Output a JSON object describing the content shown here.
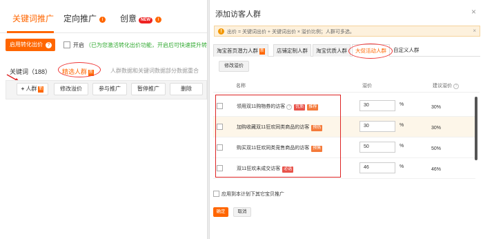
{
  "background": {
    "nav_tabs": [
      {
        "label": "关键词推广"
      },
      {
        "label": "定向推广"
      },
      {
        "label": "创意",
        "badge": "NEW"
      }
    ],
    "info_glyph": "i",
    "conversion_button": "启用转化出价",
    "conversion_button_glyph": "?",
    "open_label": "开启",
    "open_note": "（已为您激活转化出价功能，开启后可快速提升转化效",
    "subtabs": {
      "keywords": "关键词（188）",
      "crowd": "精选人群",
      "crowd_badge": "新",
      "hint": "人群数据和关键词数据部分数据重合"
    },
    "actions": [
      {
        "label": "人群",
        "plus": "+",
        "badge": "新"
      },
      {
        "label": "修改溢价"
      },
      {
        "label": "参与推广"
      },
      {
        "label": "暂停推广"
      },
      {
        "label": "删除"
      }
    ]
  },
  "modal": {
    "title": "添加访客人群",
    "close_glyph": "×",
    "warning": {
      "icon_glyph": "!",
      "text": "出价 = 关键词出价 + 关键词出价 × 溢价比例；人群可多选。",
      "close_glyph": "×"
    },
    "tabs": [
      {
        "label": "淘宝首页潜力人群",
        "badge": "新"
      },
      {
        "label": "店铺定制人群"
      },
      {
        "label": "淘宝优质人群"
      },
      {
        "label": "大促活动人群"
      },
      {
        "label": "自定义人群"
      }
    ],
    "modify_button": "修改溢价",
    "columns": {
      "name": "名称",
      "premium": "溢价",
      "suggested": "建议溢价",
      "help_glyph": "?"
    },
    "rows": [
      {
        "name": "领用双11购物券的访客",
        "help": "?",
        "tags": [
          {
            "label": "优质",
            "color": "red"
          },
          {
            "label": "推荐",
            "color": "orange"
          }
        ],
        "premium": "30",
        "unit": "%",
        "suggested": "30%"
      },
      {
        "name": "加购收藏双11狂欢同类商品的访客",
        "tags": [
          {
            "label": "预热",
            "color": "orange"
          }
        ],
        "premium": "30",
        "unit": "%",
        "suggested": "30%"
      },
      {
        "name": "购买双11狂欢同类竞售商品的访客",
        "tags": [
          {
            "label": "预售",
            "color": "orange"
          }
        ],
        "premium": "50",
        "unit": "%",
        "suggested": "50%"
      },
      {
        "name": "双11狂欢未成交访客",
        "tags": [
          {
            "label": "必选",
            "color": "red"
          }
        ],
        "premium": "46",
        "unit": "%",
        "suggested": "46%"
      }
    ],
    "apply_label": "应用到本计划下其它宝贝推广",
    "ok": "确定",
    "cancel": "取消"
  }
}
